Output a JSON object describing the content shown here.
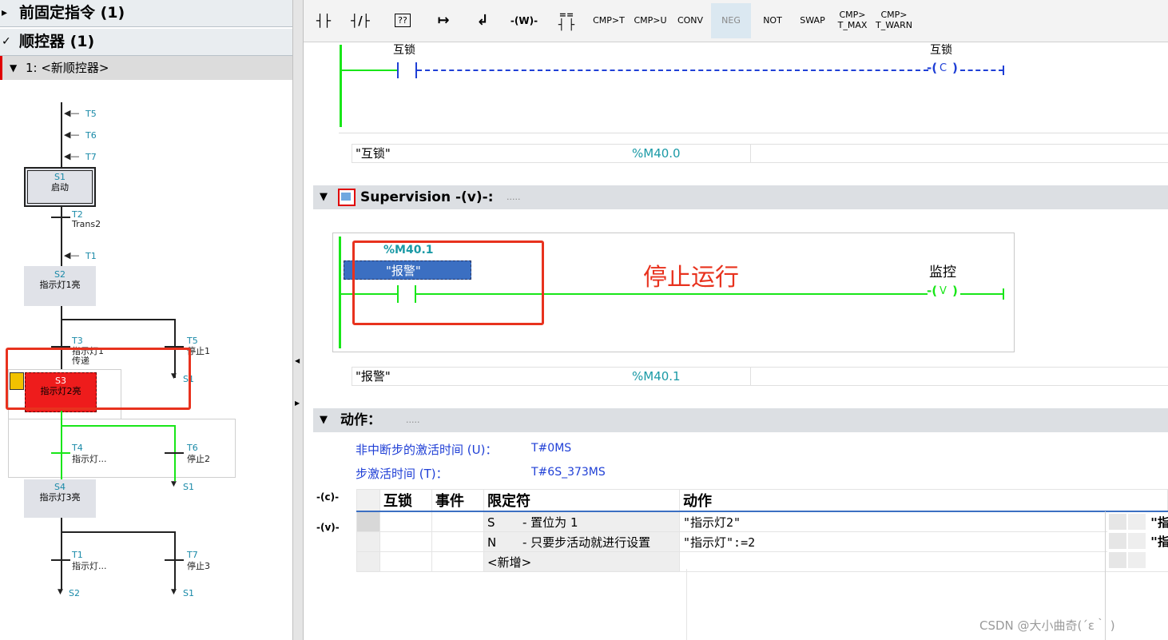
{
  "tree": {
    "prev_item": "前固定指令 (1)",
    "seq_item": "顺控器 (1)",
    "seq_name": "1: <新顺控器>"
  },
  "sequence": {
    "jumps_top": [
      "T5",
      "T6",
      "T7"
    ],
    "s1": {
      "id": "S1",
      "name": "启动"
    },
    "t2": {
      "id": "T2",
      "name": "Trans2"
    },
    "t1_in": "T1",
    "s2": {
      "id": "S2",
      "name": "指示灯1亮"
    },
    "t3": {
      "id": "T3",
      "name": "指示灯1",
      "name2": "传递"
    },
    "t5": {
      "id": "T5",
      "name": "停止1"
    },
    "s3": {
      "id": "S3",
      "name": "指示灯2亮"
    },
    "t4": {
      "id": "T4",
      "name": "指示灯..."
    },
    "t6": {
      "id": "T6",
      "name": "停止2"
    },
    "s4": {
      "id": "S4",
      "name": "指示灯3亮"
    },
    "t1": {
      "id": "T1",
      "name": "指示灯..."
    },
    "t7": {
      "id": "T7",
      "name": "停止3"
    },
    "jump_s1_a": "S1",
    "jump_s1_b": "S1",
    "jump_s2": "S2",
    "jump_s1_c": "S1"
  },
  "toolbar": {
    "no_contact": "┤├",
    "nc_contact": "┤/├",
    "box": "??",
    "open_branch": "↦",
    "close_branch": "↲",
    "coil_w": "-(W)-",
    "cmp_eq": "==",
    "cmp_t": "CMP>T",
    "cmp_u": "CMP>U",
    "conv": "CONV",
    "neg": "NEG",
    "not": "NOT",
    "swap": "SWAP",
    "cmp_tmax_1": "CMP>",
    "cmp_tmax_2": "T_MAX",
    "cmp_twarn_1": "CMP>",
    "cmp_twarn_2": "T_WARN"
  },
  "interlock": {
    "contact_label": "互锁",
    "coil_label": "互锁",
    "coil_letter": "C",
    "tag_name": "\"互锁\"",
    "tag_address": "%M40.0"
  },
  "supervision": {
    "title": "Supervision -(v)-:",
    "comment": ".....",
    "address": "%M40.1",
    "operand": "\"报警\"",
    "annotation": "停止运行",
    "coil_label": "监控",
    "coil_letter": "V",
    "tag_name": "\"报警\"",
    "tag_address": "%M40.1"
  },
  "actions": {
    "title": "动作：",
    "comment": ".....",
    "non_interrupt_label": "非中断步的激活时间 (U)：",
    "non_interrupt_value": "T#0MS",
    "activation_label": "步激活时间 (T)：",
    "activation_value": "T#6S_373MS",
    "side_c": "-(c)-",
    "side_v": "-(v)-",
    "columns": [
      "互锁",
      "事件",
      "限定符",
      "动作"
    ],
    "rows": [
      {
        "qualifier": "S",
        "qualifier_desc": "- 置位为 1",
        "action": "\"指示灯2\"",
        "right": "\"指"
      },
      {
        "qualifier": "N",
        "qualifier_desc": "- 只要步活动就进行设置",
        "action": "\"指示灯\":=2",
        "right": "\"指"
      },
      {
        "qualifier": "<新增>",
        "qualifier_desc": "",
        "action": "",
        "right": ""
      }
    ]
  },
  "watermark": "CSDN @大小曲奇(´ε｀ )",
  "colors": {
    "accent_red": "#e8321e",
    "wire_green": "#19e619",
    "wire_blue": "#1f3fd6",
    "address_teal": "#1a9aa6",
    "selection_blue": "#3b6fc2"
  }
}
